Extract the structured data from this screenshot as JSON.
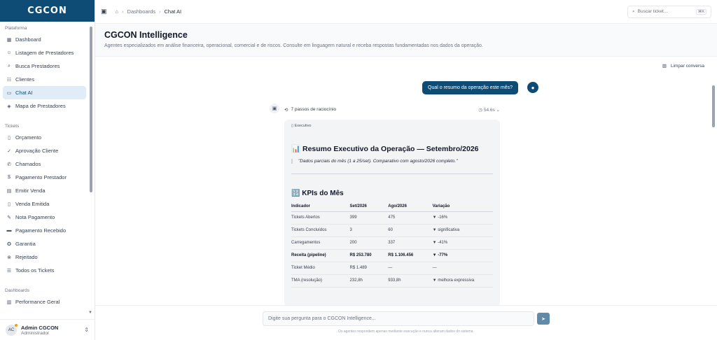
{
  "brand": "CGCON",
  "sidebar": {
    "sections": [
      {
        "label": "Plataforma",
        "items": [
          {
            "label": "Dashboard",
            "icon": "grid-icon",
            "glyph": "▦"
          },
          {
            "label": "Listagem de Prestadores",
            "icon": "users-icon",
            "glyph": "☺"
          },
          {
            "label": "Busca Prestadores",
            "icon": "search-icon",
            "glyph": "⌕"
          },
          {
            "label": "Clientes",
            "icon": "group-icon",
            "glyph": "☷"
          },
          {
            "label": "Chat AI",
            "icon": "chat-icon",
            "glyph": "▭",
            "active": true
          },
          {
            "label": "Mapa de Prestadores",
            "icon": "shield-icon",
            "glyph": "◈"
          }
        ]
      },
      {
        "label": "Tickets",
        "items": [
          {
            "label": "Orçamento",
            "icon": "document-icon",
            "glyph": "▯"
          },
          {
            "label": "Aprovação Cliente",
            "icon": "check-circle-icon",
            "glyph": "✓"
          },
          {
            "label": "Chamados",
            "icon": "phone-icon",
            "glyph": "✆"
          },
          {
            "label": "Pagamento Prestador",
            "icon": "dollar-icon",
            "glyph": "$"
          },
          {
            "label": "Emitir Venda",
            "icon": "invoice-icon",
            "glyph": "▤"
          },
          {
            "label": "Venda Emitida",
            "icon": "document-icon",
            "glyph": "▯"
          },
          {
            "label": "Nota Pagamento",
            "icon": "edit-icon",
            "glyph": "✎"
          },
          {
            "label": "Pagamento Recebido",
            "icon": "card-icon",
            "glyph": "▬"
          },
          {
            "label": "Garantia",
            "icon": "badge-icon",
            "glyph": "✪"
          },
          {
            "label": "Rejeitado",
            "icon": "x-circle-icon",
            "glyph": "⊗"
          },
          {
            "label": "Todos os Tickets",
            "icon": "list-icon",
            "glyph": "☰"
          }
        ]
      },
      {
        "label": "Dashboards",
        "items": [
          {
            "label": "Performance Geral",
            "icon": "bar-chart-icon",
            "glyph": "▥"
          }
        ]
      }
    ],
    "user": {
      "initials": "AC",
      "name": "Admin CGCON",
      "role": "Administrador"
    }
  },
  "topbar": {
    "breadcrumb": [
      "Dashboards",
      "Chat AI"
    ],
    "search_placeholder": "Buscar ticket...",
    "search_shortcut": "⌘K"
  },
  "header": {
    "title": "CGCON Intelligence",
    "subtitle": "Agentes especializados em análise financeira, operacional, comercial e de riscos. Consulte em linguagem natural e receba respostas fundamentadas nos dados da operação.",
    "clear_label": "Limpar conversa"
  },
  "chat": {
    "user_message": "Qual o resumo da operação este mês?",
    "steps_label": "7 passos de raciocínio",
    "steps_time": "54.6s",
    "response": {
      "tag": "Executivo",
      "title": "📊 Resumo Executivo da Operação — Setembro/2026",
      "quote": "\"Dados parciais do mês (1 a 25/set). Comparativo com agosto/2026 completo.\"",
      "kpi_title": "🔢 KPIs do Mês",
      "table": {
        "headers": [
          "Indicador",
          "Set/2026",
          "Ago/2026",
          "Variação"
        ],
        "rows": [
          {
            "cells": [
              "Tickets Abertos",
              "399",
              "475",
              "▼ -16%"
            ]
          },
          {
            "cells": [
              "Tickets Concluídos",
              "3",
              "60",
              "▼ significativa"
            ]
          },
          {
            "cells": [
              "Carregamentos",
              "200",
              "337",
              "▼ -41%"
            ]
          },
          {
            "cells": [
              "Receita (pipeline)",
              "R$ 253.780",
              "R$ 1.106.456",
              "▼ -77%"
            ],
            "bold": true
          },
          {
            "cells": [
              "Ticket Médio",
              "R$ 1.489",
              "—",
              "—"
            ]
          },
          {
            "cells": [
              "TMA (resolução)",
              "232,8h",
              "933,8h",
              "▼ melhora expressiva"
            ]
          }
        ]
      }
    }
  },
  "composer": {
    "placeholder": "Digite sua pergunta para o CGCON Intelligence...",
    "disclaimer": "Os agentes respondem apenas mediante execução e nunca alteram dados do sistema."
  }
}
